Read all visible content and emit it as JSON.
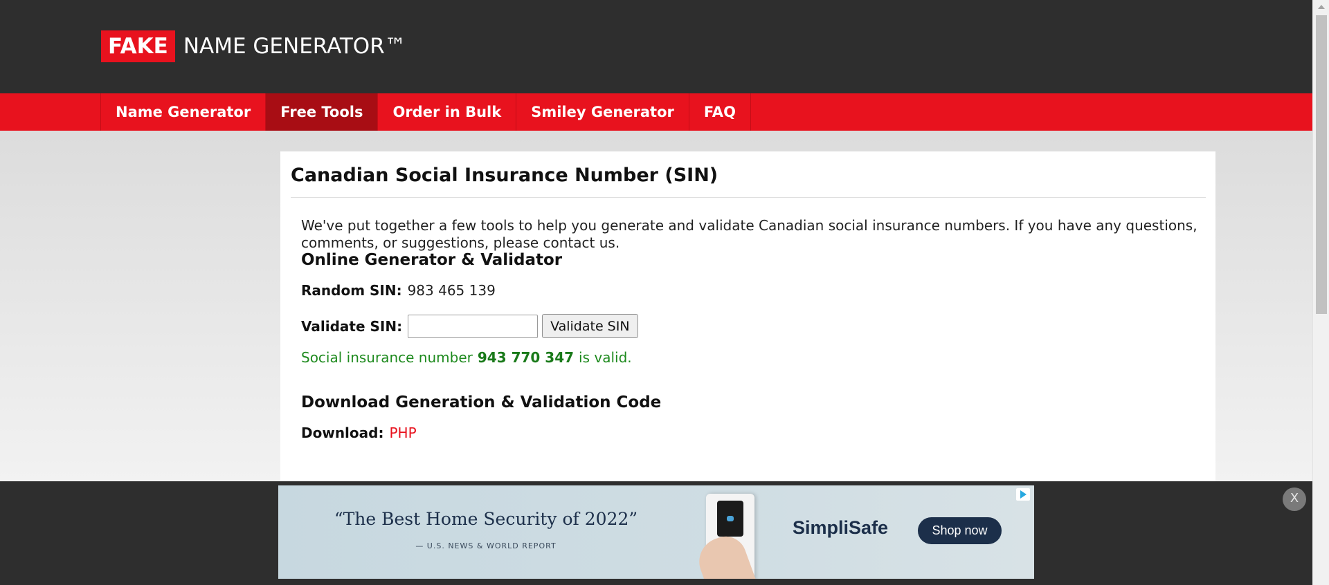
{
  "header": {
    "logo_fake": "FAKE",
    "logo_rest": "NAME GENERATOR™"
  },
  "nav": {
    "items": [
      {
        "label": "Name Generator",
        "active": false
      },
      {
        "label": "Free Tools",
        "active": true
      },
      {
        "label": "Order in Bulk",
        "active": false
      },
      {
        "label": "Smiley Generator",
        "active": false
      },
      {
        "label": "FAQ",
        "active": false
      }
    ]
  },
  "main": {
    "title": "Canadian Social Insurance Number (SIN)",
    "intro": "We've put together a few tools to help you generate and validate Canadian social insurance numbers. If you have any questions, comments, or suggestions, please contact us.",
    "generator_heading": "Online Generator & Validator",
    "random_label": "Random SIN:",
    "random_value": "983 465 139",
    "validate_label": "Validate SIN:",
    "validate_input_value": "",
    "validate_button": "Validate SIN",
    "valid_prefix": "Social insurance number",
    "valid_number": "943 770 347",
    "valid_suffix": "is valid.",
    "download_heading": "Download Generation & Validation Code",
    "download_label": "Download:",
    "download_link": "PHP"
  },
  "ad": {
    "quote": "“The Best Home Security of 2022”",
    "source": "— U.S. NEWS & WORLD REPORT",
    "brand": "SimpliSafe",
    "cta": "Shop now",
    "close": "X"
  },
  "colors": {
    "header_bg": "#2e2e2e",
    "nav_bg": "#e8121e",
    "nav_active": "#a80d14",
    "valid_green": "#1e8a1e",
    "link_red": "#e8121e"
  }
}
